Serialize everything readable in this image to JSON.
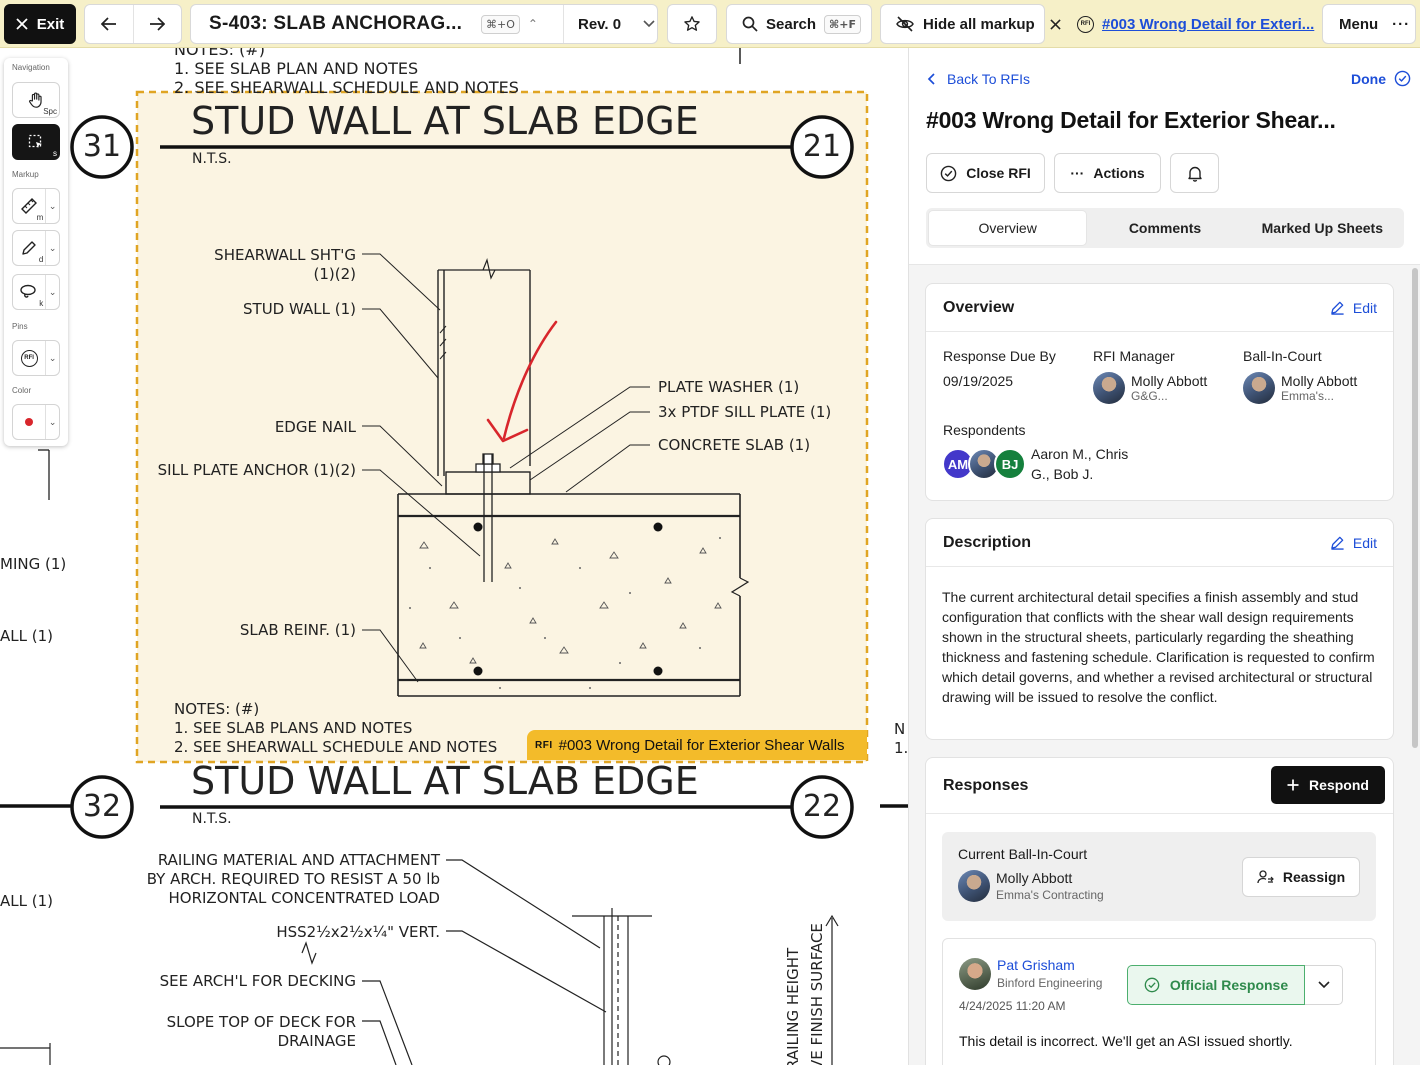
{
  "topbar": {
    "exit_label": "Exit",
    "sheet_name": "S-403: SLAB ANCHORAG...",
    "sheet_shortcut": "⌘+O",
    "revision": "Rev. 0",
    "search_label": "Search",
    "search_shortcut": "⌘+F",
    "hide_markup_label": "Hide all markup",
    "rfi_badge": "RFI",
    "rfi_link": "#003 Wrong Detail for Exteri...",
    "menu_label": "Menu"
  },
  "toolbox": {
    "navigation_caption": "Navigation",
    "markup_caption": "Markup",
    "pins_caption": "Pins",
    "color_caption": "Color",
    "pan_shortcut": "Spc",
    "select_shortcut": "s",
    "ruler_shortcut": "m",
    "draw_shortcut": "d",
    "cloud_shortcut": "k",
    "pin_badge": "RFI",
    "current_color": "#d8262c"
  },
  "drawing": {
    "top_notes_heading": "NOTES: (#)",
    "top_note_1": "1.  SEE SLAB PLAN AND NOTES",
    "top_note_2": "2.  SEE SHEARWALL SCHEDULE AND NOTES",
    "detail1": {
      "title": "STUD WALL AT SLAB EDGE",
      "scale": "N.T.S.",
      "number_left": "31",
      "number_right": "21",
      "label_shearwall_1": "SHEARWALL SHT'G",
      "label_shearwall_2": "(1)(2)",
      "label_stud_wall": "STUD WALL (1)",
      "label_edge_nail": "EDGE NAIL",
      "label_sill_anchor": "SILL PLATE ANCHOR (1)(2)",
      "label_slab_reinf": "SLAB REINF. (1)",
      "label_plate_washer": "PLATE WASHER (1)",
      "label_sill_plate": "3x PTDF SILL PLATE (1)",
      "label_concrete_slab": "CONCRETE SLAB (1)",
      "notes_heading": "NOTES: (#)",
      "note_1": "1.  SEE SLAB PLANS AND NOTES",
      "note_2": "2.  SEE SHEARWALL SCHEDULE AND NOTES"
    },
    "detail2": {
      "title": "STUD WALL AT SLAB EDGE",
      "scale": "N.T.S.",
      "number_left": "32",
      "number_right": "22",
      "railing_1": "RAILING MATERIAL AND ATTACHMENT",
      "railing_2": "BY ARCH. REQUIRED TO RESIST A 50 lb",
      "railing_3": "HORIZONTAL CONCENTRATED LOAD",
      "hss": "HSS2½x2½x¼\" VERT.",
      "decking": "SEE ARCH'L FOR DECKING",
      "slope_1": "SLOPE TOP OF DECK FOR",
      "slope_2": "DRAINAGE",
      "railing_height": "RAILING HEIGHT",
      "finish_surface": "VE FINISH SURFACE"
    },
    "left_edge_1": "MING (1)",
    "left_edge_2": "ALL (1)",
    "left_edge_3": "ALL (1)",
    "right_edge_1": "N",
    "right_edge_2": "1.",
    "pin_badge": "RFI",
    "pin_label": "#003 Wrong Detail for Exterior Shear Walls"
  },
  "panel": {
    "back_label": "Back To RFIs",
    "done_label": "Done",
    "title": "#003 Wrong Detail for Exterior Shear...",
    "close_rfi_label": "Close RFI",
    "actions_label": "Actions",
    "tabs": [
      "Overview",
      "Comments",
      "Marked Up Sheets"
    ],
    "active_tab": "Overview",
    "overview": {
      "heading": "Overview",
      "edit_label": "Edit",
      "due_label": "Response Due By",
      "due_value": "09/19/2025",
      "manager_label": "RFI Manager",
      "manager_name": "Molly Abbott",
      "manager_company": "G&G...",
      "bic_label": "Ball-In-Court",
      "bic_name": "Molly Abbott",
      "bic_company": "Emma's...",
      "respondents_label": "Respondents",
      "respondent_initials": [
        "AM",
        "BJ"
      ],
      "respondents_line1": "Aaron M., Chris",
      "respondents_line2": "G., Bob J."
    },
    "description": {
      "heading": "Description",
      "edit_label": "Edit",
      "text": "The current architectural detail specifies a finish assembly and stud configuration that conflicts with the shear wall design requirements shown in the structural sheets, particularly regarding the sheathing thickness and fastening schedule. Clarification is requested to confirm which detail governs, and whether a revised architectural or structural drawing will be issued to resolve the conflict."
    },
    "responses": {
      "heading": "Responses",
      "respond_label": "Respond",
      "current_bic_label": "Current Ball-In-Court",
      "current_bic_name": "Molly Abbott",
      "current_bic_company": "Emma's Contracting",
      "reassign_label": "Reassign",
      "response_author": "Pat Grisham",
      "response_company": "Binford Engineering",
      "response_date": "4/24/2025 11:20 AM",
      "official_label": "Official Response",
      "response_text": "This detail is incorrect. We'll get an ASI issued shortly."
    }
  },
  "colors": {
    "topbar_bg": "#f6f0c8",
    "link_blue": "#1d4ed8",
    "markup_highlight": "#fbf4e2",
    "markup_border": "#e0a523",
    "pin_label_bg": "#f3bb2a",
    "markup_arrow": "#d8262c",
    "avatar_am": "#4338ca",
    "avatar_bj": "#15803d",
    "official_green": "#2f8a4c"
  }
}
